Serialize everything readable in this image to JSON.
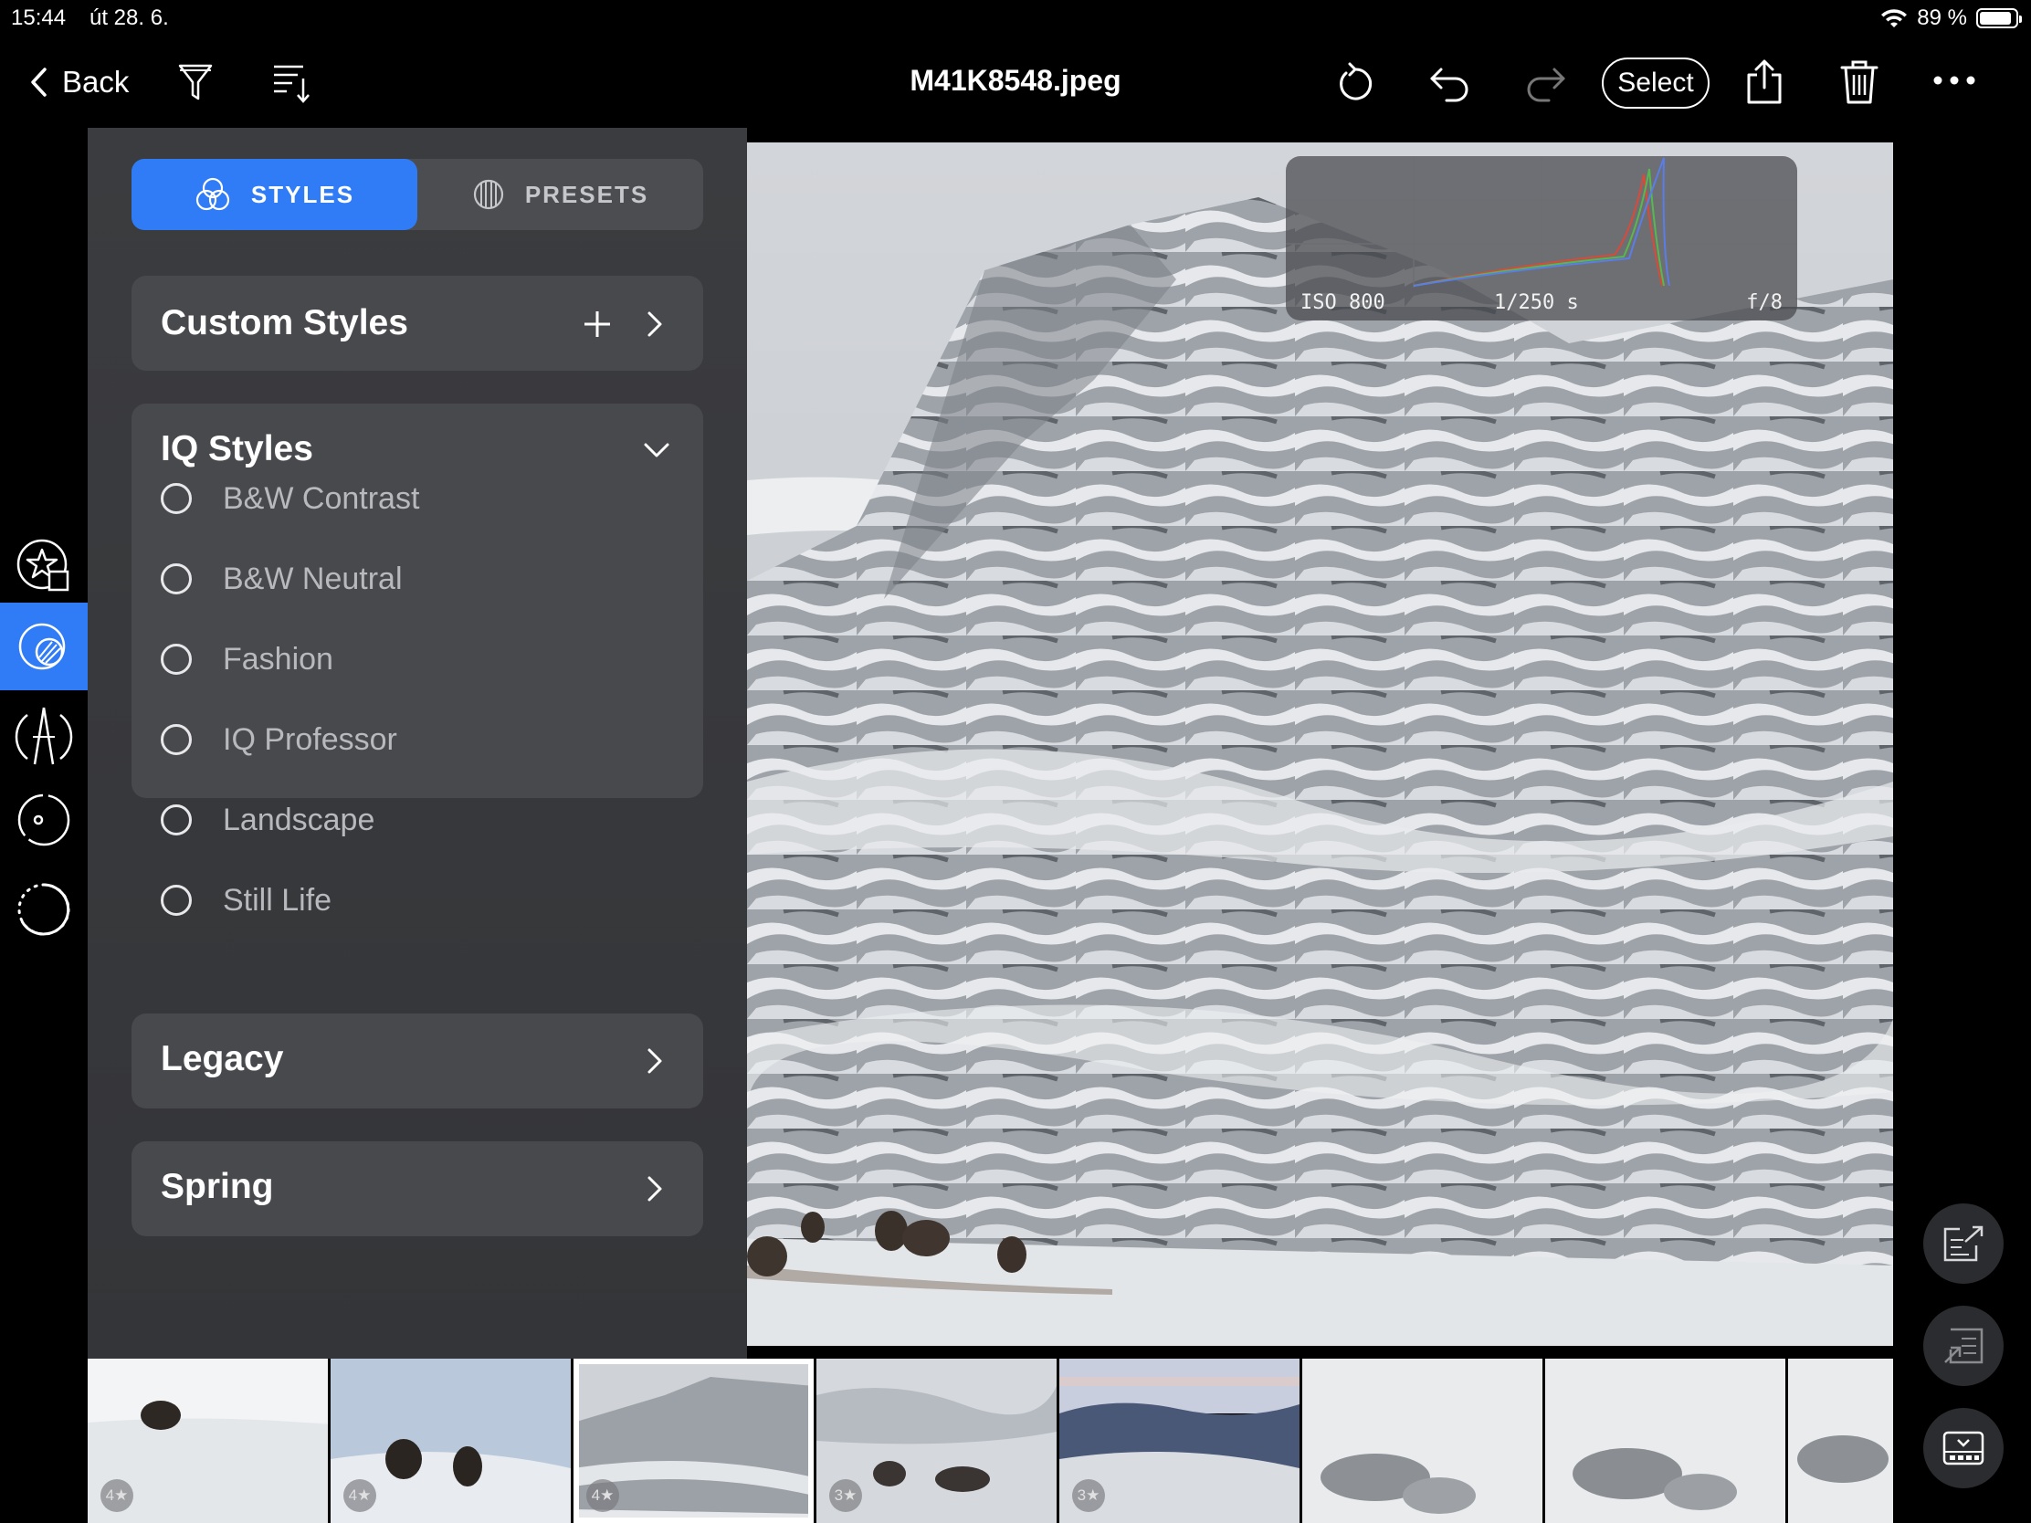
{
  "status_bar": {
    "time": "15:44",
    "date": "út 28. 6.",
    "battery": "89 %",
    "battery_level": 0.89
  },
  "toolbar": {
    "back_label": "Back",
    "file_title": "M41K8548.jpeg",
    "select_label": "Select",
    "icons": [
      "filter-icon",
      "sort-icon",
      "rotate-icon",
      "undo-icon",
      "redo-icon",
      "share-icon",
      "trash-icon",
      "more-icon"
    ]
  },
  "panel": {
    "tabs": [
      {
        "label": "STYLES",
        "active": true
      },
      {
        "label": "PRESETS",
        "active": false
      }
    ],
    "custom_styles": {
      "title": "Custom Styles"
    },
    "iq_styles": {
      "title": "IQ Styles",
      "options": [
        "B&W Contrast",
        "B&W Neutral",
        "Fashion",
        "IQ Professor",
        "Landscape",
        "Still Life"
      ]
    },
    "legacy": {
      "title": "Legacy"
    },
    "spring": {
      "title": "Spring"
    }
  },
  "histogram": {
    "iso": "ISO 800",
    "shutter": "1/250 s",
    "aperture": "f/8"
  },
  "filmstrip": [
    {
      "rating": "4★",
      "selected": false
    },
    {
      "rating": "4★",
      "selected": false
    },
    {
      "rating": "4★",
      "selected": true
    },
    {
      "rating": "3★",
      "selected": false
    },
    {
      "rating": "3★",
      "selected": false
    },
    {
      "rating": "",
      "selected": false
    },
    {
      "rating": "",
      "selected": false
    },
    {
      "rating": "",
      "selected": false
    }
  ],
  "colors": {
    "accent": "#2f7cf6",
    "panel": "#3b3c3f",
    "card": "#48494d"
  }
}
